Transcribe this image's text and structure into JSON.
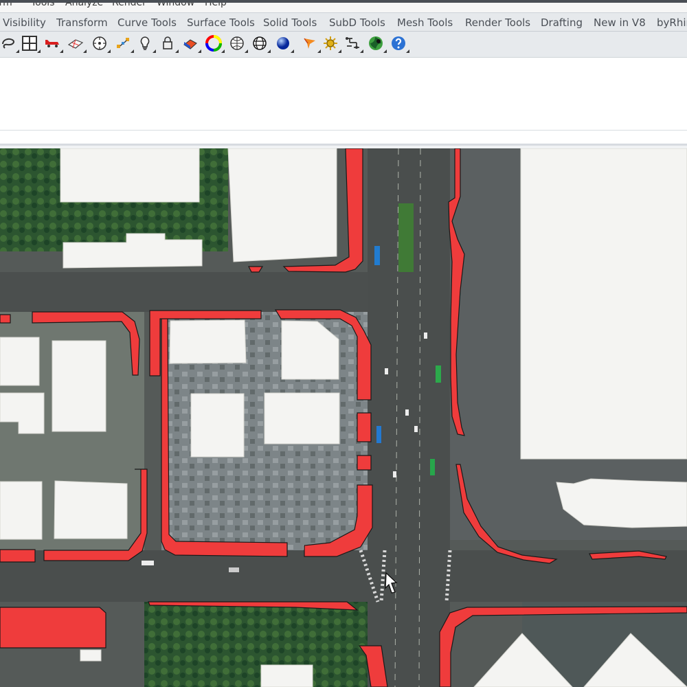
{
  "menubar": {
    "items": [
      "orm",
      "Tools",
      "Analyze",
      "Render",
      "Window",
      "Help"
    ]
  },
  "tabs": [
    "Visibility",
    "Transform",
    "Curve Tools",
    "Surface Tools",
    "Solid Tools",
    "SubD Tools",
    "Mesh Tools",
    "Render Tools",
    "Drafting",
    "New in V8",
    "byRhin"
  ],
  "toolbar": {
    "icons": [
      "lasso-icon",
      "grid-icon",
      "car-icon",
      "plane-icon",
      "target-icon",
      "network-icon",
      "lightbulb-icon",
      "lock-icon",
      "material-icon",
      "color-wheel-icon",
      "sphere-wire-icon",
      "globe-grid-icon",
      "render-sphere-icon",
      "funnel-icon",
      "gear-icon",
      "flowchart-icon",
      "green-globe-icon",
      "help-icon"
    ]
  },
  "colors": {
    "accent_red": "#ef3c3c",
    "building_white": "#f4f4f2",
    "road_dark": "#4f5352",
    "tree_green": "#264f2b"
  }
}
